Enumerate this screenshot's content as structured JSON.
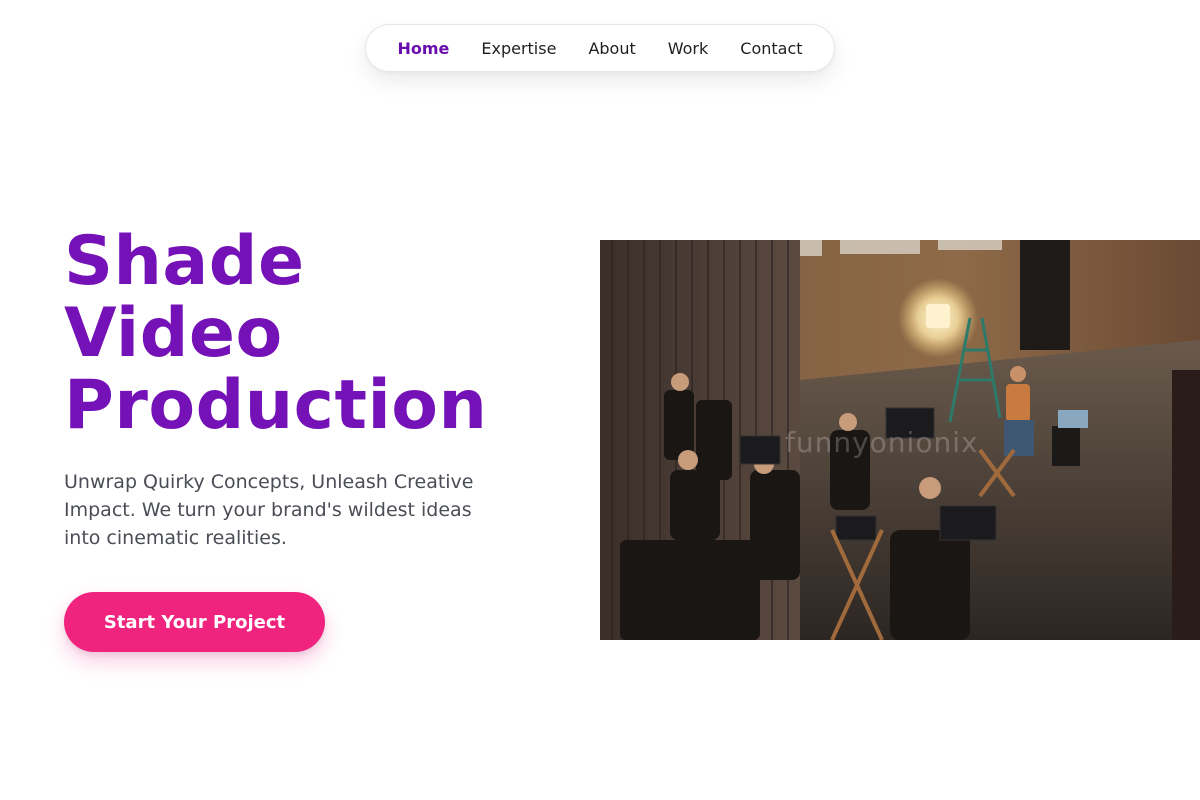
{
  "nav": {
    "items": [
      {
        "label": "Home",
        "active": true
      },
      {
        "label": "Expertise",
        "active": false
      },
      {
        "label": "About",
        "active": false
      },
      {
        "label": "Work",
        "active": false
      },
      {
        "label": "Contact",
        "active": false
      }
    ]
  },
  "hero": {
    "title_lines": [
      "Shade",
      "Video",
      "Production"
    ],
    "subtitle": "Unwrap Quirky Concepts, Unleash Creative Impact. We turn your brand's wildest ideas into cinematic realities.",
    "cta_label": "Start Your Project"
  },
  "photo": {
    "watermark": "funnyonionix"
  },
  "colors": {
    "brand_purple": "#7412b8",
    "cta_pink": "#f0247f",
    "text_muted": "#4a4d55"
  }
}
